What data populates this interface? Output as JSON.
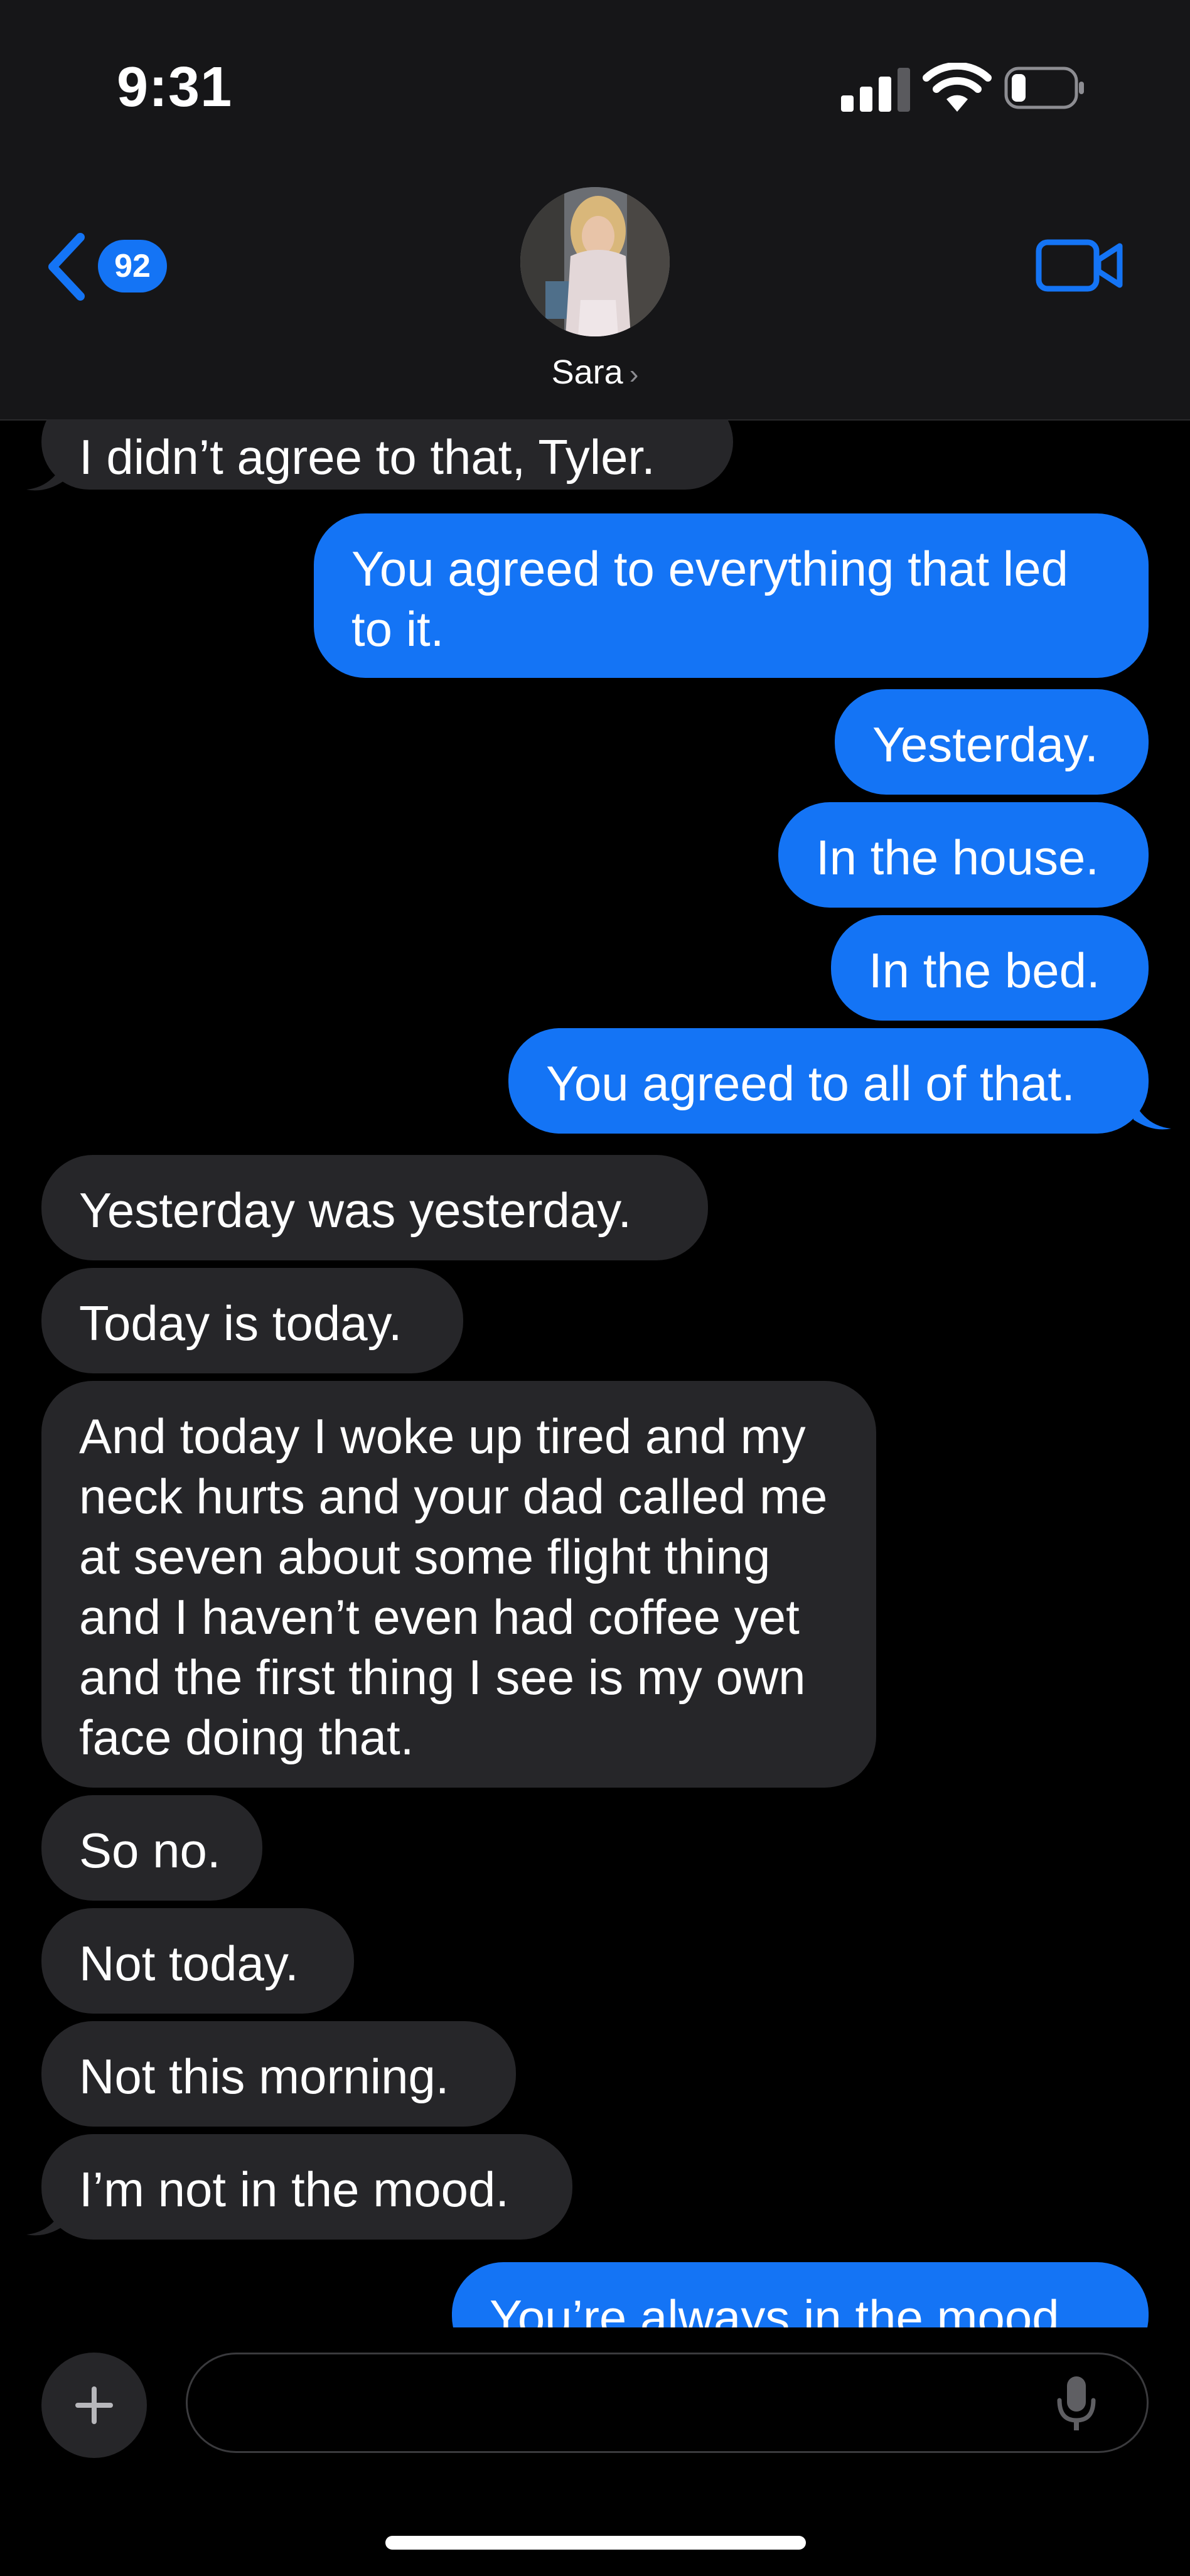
{
  "status": {
    "time": "9:31"
  },
  "header": {
    "back_count": "92",
    "contact_name": "Sara",
    "contact_chevron": "›"
  },
  "messages": [
    {
      "dir": "in",
      "text": "I didn’t agree to that, Tyler."
    },
    {
      "dir": "out",
      "text": "You agreed to everything that led to it."
    },
    {
      "dir": "out",
      "text": "Yesterday."
    },
    {
      "dir": "out",
      "text": "In the house."
    },
    {
      "dir": "out",
      "text": "In the bed."
    },
    {
      "dir": "out",
      "text": "You agreed to all of that."
    },
    {
      "dir": "in",
      "text": "Yesterday was yesterday."
    },
    {
      "dir": "in",
      "text": "Today is today."
    },
    {
      "dir": "in",
      "text": "And today I woke up tired and my neck hurts and your dad called me at seven about some flight thing and I haven’t even had coffee yet and the first thing I see is my own face doing that."
    },
    {
      "dir": "in",
      "text": "So no."
    },
    {
      "dir": "in",
      "text": "Not today."
    },
    {
      "dir": "in",
      "text": "Not this morning."
    },
    {
      "dir": "in",
      "text": "I’m not in the mood."
    },
    {
      "dir": "out",
      "text": "You’re always in the mood."
    }
  ],
  "composer": {
    "value": "",
    "placeholder": ""
  },
  "icons": {
    "back": "chevron-left-icon",
    "video": "video-camera-icon",
    "plus": "plus-icon",
    "mic": "microphone-icon"
  },
  "colors": {
    "outgoing": "#1474f5",
    "incoming": "#262629",
    "header_bg": "#161618",
    "background": "#000000"
  }
}
